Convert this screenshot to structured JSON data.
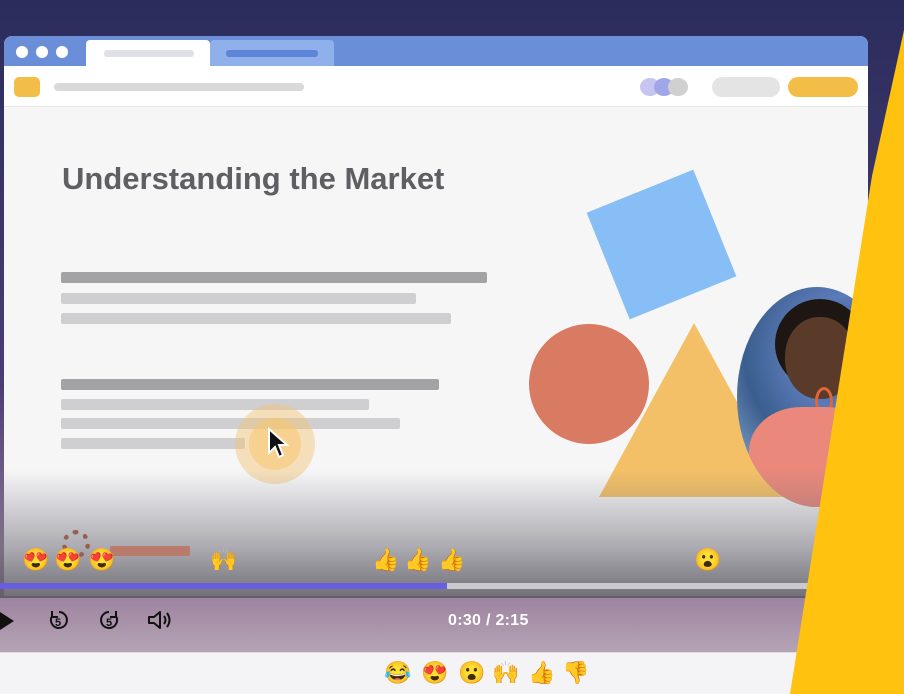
{
  "slide": {
    "title": "Understanding the Market"
  },
  "player": {
    "current_time": "0:30",
    "separator": " / ",
    "duration": "2:15",
    "progress_fraction": 0.545,
    "rewind_seconds": "5",
    "forward_seconds": "5"
  },
  "timeline_reactions": [
    {
      "glyph": "😍"
    },
    {
      "glyph": "😍"
    },
    {
      "glyph": "😍"
    },
    {
      "glyph": "🙌"
    },
    {
      "glyph": "👍"
    },
    {
      "glyph": "👍"
    },
    {
      "glyph": "👍"
    },
    {
      "glyph": "😮"
    }
  ],
  "reaction_bar": [
    {
      "glyph": "😂",
      "name": "laugh"
    },
    {
      "glyph": "😍",
      "name": "heart-eyes"
    },
    {
      "glyph": "😮",
      "name": "wow"
    },
    {
      "glyph": "🙌",
      "name": "raised-hands"
    },
    {
      "glyph": "👍",
      "name": "thumbs-up"
    },
    {
      "glyph": "👎",
      "name": "thumbs-down"
    }
  ],
  "colors": {
    "accent_yellow": "#ffc20e",
    "progress": "#6a5ee0",
    "tab_bar": "#6a8ed8"
  }
}
